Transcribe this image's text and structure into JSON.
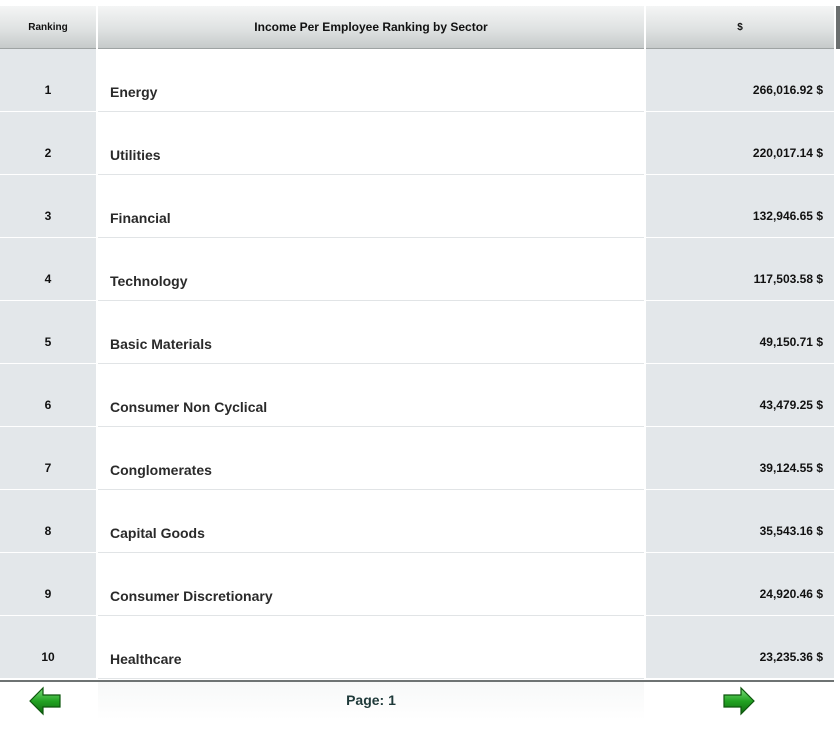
{
  "header": {
    "ranking": "Ranking",
    "title": "Income Per Employee Ranking by Sector",
    "currency": "$"
  },
  "rows": [
    {
      "rank": "1",
      "sector": "Energy",
      "value": "266,016.92 $"
    },
    {
      "rank": "2",
      "sector": "Utilities",
      "value": "220,017.14 $"
    },
    {
      "rank": "3",
      "sector": "Financial",
      "value": "132,946.65 $"
    },
    {
      "rank": "4",
      "sector": "Technology",
      "value": "117,503.58 $"
    },
    {
      "rank": "5",
      "sector": "Basic Materials",
      "value": "49,150.71 $"
    },
    {
      "rank": "6",
      "sector": "Consumer Non Cyclical",
      "value": "43,479.25 $"
    },
    {
      "rank": "7",
      "sector": "Conglomerates",
      "value": "39,124.55 $"
    },
    {
      "rank": "8",
      "sector": "Capital Goods",
      "value": "35,543.16 $"
    },
    {
      "rank": "9",
      "sector": "Consumer Discretionary",
      "value": "24,920.46 $"
    },
    {
      "rank": "10",
      "sector": "Healthcare",
      "value": "23,235.36 $"
    }
  ],
  "footer": {
    "page_label": "Page: 1",
    "prev_icon": "green-arrow-left-icon",
    "next_icon": "green-arrow-right-icon"
  },
  "colors": {
    "arrow_green": "#1e8a1e",
    "row_shade": "#e3e7ea"
  }
}
